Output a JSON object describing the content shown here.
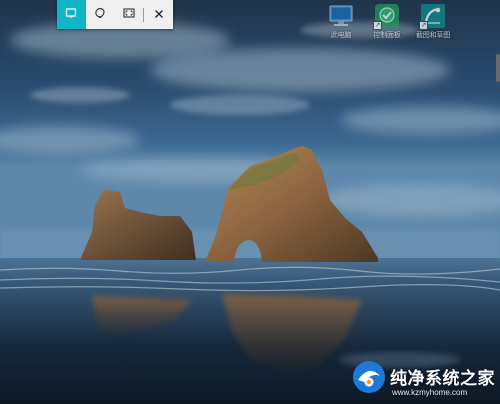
{
  "snip_toolbar": {
    "modes": [
      {
        "icon": "rectangle-snip-icon",
        "active": true
      },
      {
        "icon": "freeform-snip-icon",
        "active": false
      },
      {
        "icon": "fullscreen-snip-icon",
        "active": false
      }
    ],
    "close_icon": "close-icon",
    "accent": "#12b5c8"
  },
  "desktop": {
    "icons": [
      {
        "label": "此电脑",
        "icon": "this-pc-icon"
      },
      {
        "label": "控制面板",
        "icon": "control-panel-icon"
      },
      {
        "label": "截图和草图",
        "icon": "snip-sketch-icon"
      }
    ]
  },
  "watermark": {
    "title": "纯净系统之家",
    "url": "www.kzmyhome.com"
  }
}
